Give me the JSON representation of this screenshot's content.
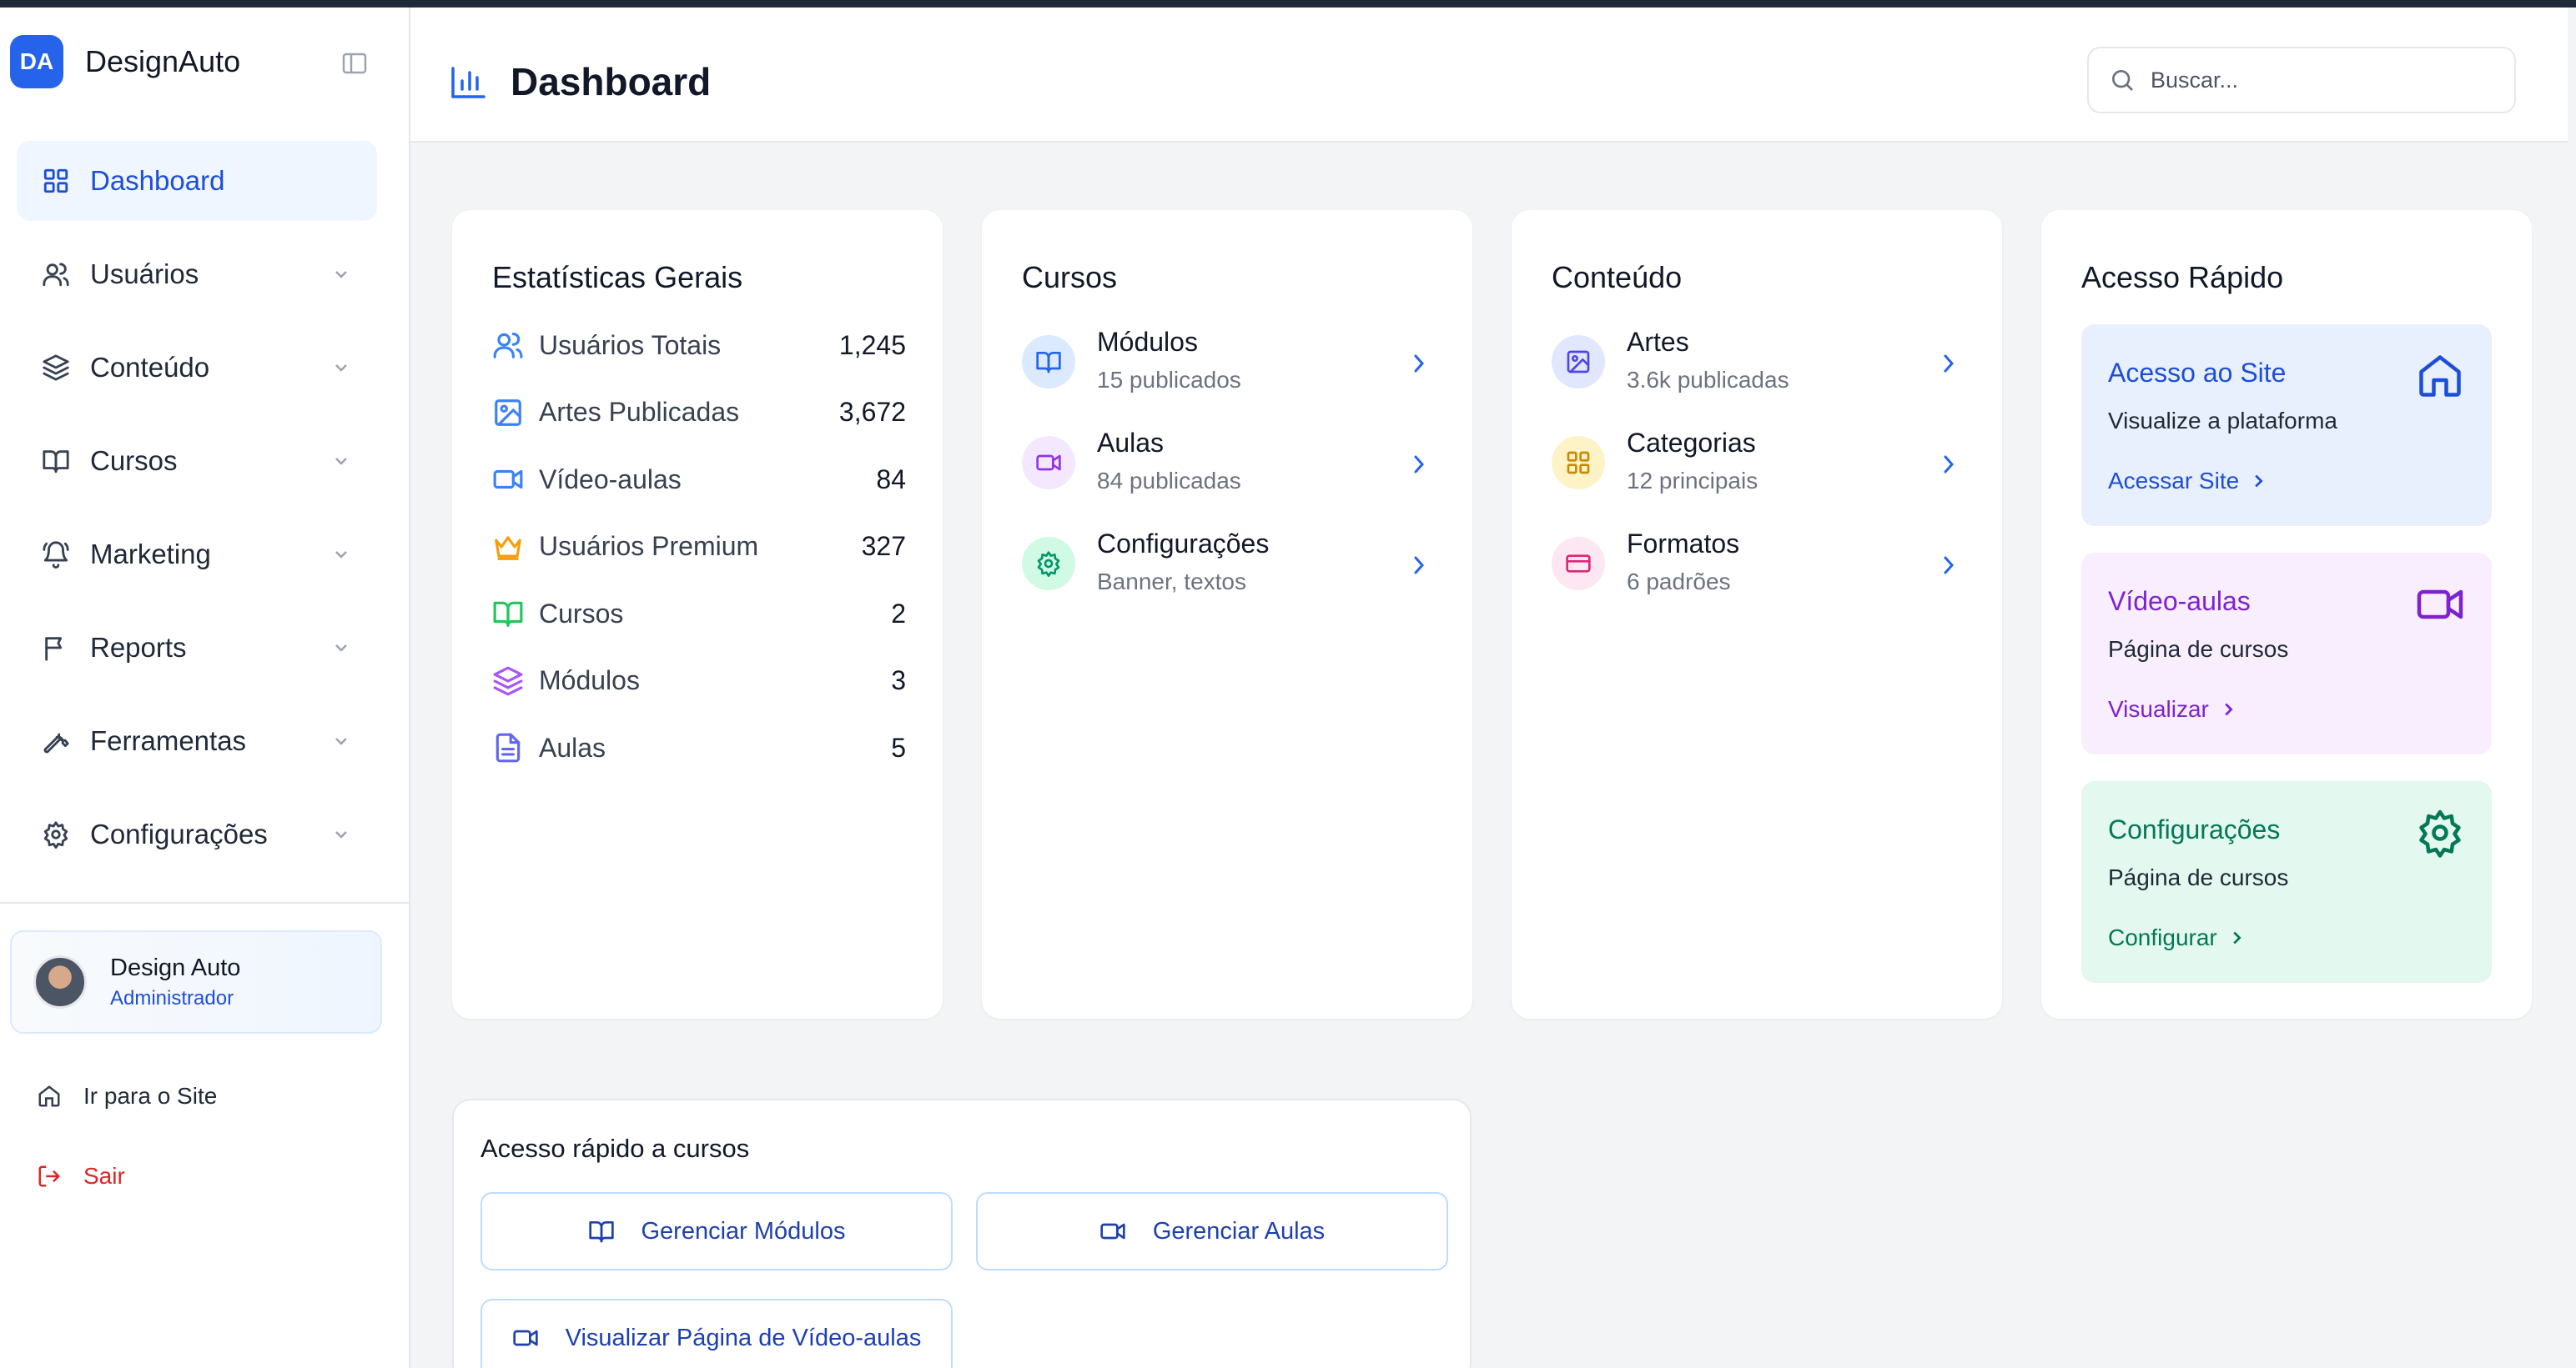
{
  "brand": {
    "logo_text": "DA",
    "name": "DesignAuto"
  },
  "sidebar": {
    "items": [
      {
        "label": "Dashboard",
        "icon": "grid-icon",
        "active": true
      },
      {
        "label": "Usuários",
        "icon": "users-icon"
      },
      {
        "label": "Conteúdo",
        "icon": "layers-icon"
      },
      {
        "label": "Cursos",
        "icon": "book-icon"
      },
      {
        "label": "Marketing",
        "icon": "bell-icon"
      },
      {
        "label": "Reports",
        "icon": "flag-icon"
      },
      {
        "label": "Ferramentas",
        "icon": "wrench-icon"
      },
      {
        "label": "Configurações",
        "icon": "gear-icon"
      }
    ],
    "user": {
      "name": "Design Auto",
      "role": "Administrador"
    },
    "site_link": "Ir para o Site",
    "logout": "Sair"
  },
  "header": {
    "title": "Dashboard",
    "search_placeholder": "Buscar..."
  },
  "stats": {
    "title": "Estatísticas Gerais",
    "rows": [
      {
        "label": "Usuários Totais",
        "value": "1,245",
        "icon": "users-icon",
        "color": "#3b82f6"
      },
      {
        "label": "Artes Publicadas",
        "value": "3,672",
        "icon": "image-icon",
        "color": "#3b82f6"
      },
      {
        "label": "Vídeo-aulas",
        "value": "84",
        "icon": "video-icon",
        "color": "#3b82f6"
      },
      {
        "label": "Usuários Premium",
        "value": "327",
        "icon": "crown-icon",
        "color": "#f59e0b"
      },
      {
        "label": "Cursos",
        "value": "2",
        "icon": "book-icon",
        "color": "#22c55e"
      },
      {
        "label": "Módulos",
        "value": "3",
        "icon": "layers-icon",
        "color": "#a855f7"
      },
      {
        "label": "Aulas",
        "value": "5",
        "icon": "file-icon",
        "color": "#6366f1"
      }
    ]
  },
  "cursos": {
    "title": "Cursos",
    "items": [
      {
        "title": "Módulos",
        "subtitle": "15 publicados",
        "icon": "book-icon",
        "color": "#2563eb",
        "bg": "#dbeafe"
      },
      {
        "title": "Aulas",
        "subtitle": "84 publicadas",
        "icon": "video-icon",
        "color": "#9333ea",
        "bg": "#f3e8ff"
      },
      {
        "title": "Configurações",
        "subtitle": "Banner, textos",
        "icon": "gear-icon",
        "color": "#059669",
        "bg": "#d1fae5"
      }
    ]
  },
  "conteudo": {
    "title": "Conteúdo",
    "items": [
      {
        "title": "Artes",
        "subtitle": "3.6k publicadas",
        "icon": "image-icon",
        "color": "#4f46e5",
        "bg": "#e0e7ff"
      },
      {
        "title": "Categorias",
        "subtitle": "12 principais",
        "icon": "grid-icon",
        "color": "#ca8a04",
        "bg": "#fef3c7"
      },
      {
        "title": "Formatos",
        "subtitle": "6 padrões",
        "icon": "card-icon",
        "color": "#db2777",
        "bg": "#fce7f3"
      }
    ]
  },
  "acesso": {
    "title": "Acesso Rápido",
    "items": [
      {
        "title": "Acesso ao Site",
        "desc": "Visualize a plataforma",
        "link": "Acessar Site",
        "icon": "home-icon",
        "color": "#1d4ed8",
        "bg": "#e8f0fe"
      },
      {
        "title": "Vídeo-aulas",
        "desc": "Página de cursos",
        "link": "Visualizar",
        "icon": "video-icon",
        "color": "#7e22ce",
        "bg": "#f8eefd"
      },
      {
        "title": "Configurações",
        "desc": "Página de cursos",
        "link": "Configurar",
        "icon": "gear-icon",
        "color": "#047857",
        "bg": "#e3f8ee"
      }
    ]
  },
  "cursos_rapido": {
    "title": "Acesso rápido a cursos",
    "buttons": [
      {
        "label": "Gerenciar Módulos",
        "icon": "book-icon"
      },
      {
        "label": "Gerenciar Aulas",
        "icon": "video-icon"
      },
      {
        "label": "Visualizar Página de Vídeo-aulas",
        "icon": "video-icon"
      }
    ]
  }
}
